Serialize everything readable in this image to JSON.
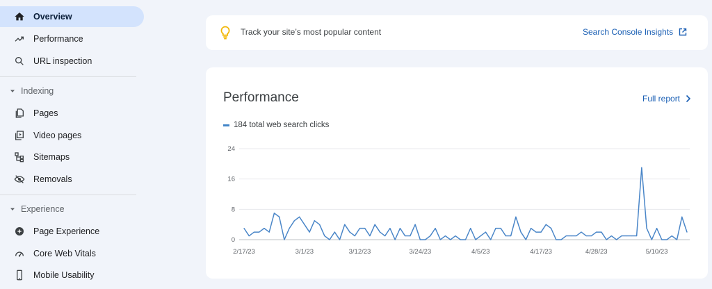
{
  "sidebar": {
    "items": [
      {
        "label": "Overview",
        "icon": "home-icon",
        "active": true
      },
      {
        "label": "Performance",
        "icon": "trending-up-icon"
      },
      {
        "label": "URL inspection",
        "icon": "search-icon"
      }
    ],
    "indexing": {
      "header": "Indexing",
      "items": [
        {
          "label": "Pages",
          "icon": "pages-icon"
        },
        {
          "label": "Video pages",
          "icon": "video-pages-icon"
        },
        {
          "label": "Sitemaps",
          "icon": "sitemap-icon"
        },
        {
          "label": "Removals",
          "icon": "removals-icon"
        }
      ]
    },
    "experience": {
      "header": "Experience",
      "items": [
        {
          "label": "Page Experience",
          "icon": "page-experience-icon"
        },
        {
          "label": "Core Web Vitals",
          "icon": "speedometer-icon"
        },
        {
          "label": "Mobile Usability",
          "icon": "mobile-icon"
        }
      ]
    }
  },
  "insight": {
    "text": "Track your site’s most popular content",
    "link": "Search Console Insights",
    "icon": "lightbulb-icon",
    "link_icon": "open-in-new-icon"
  },
  "performance": {
    "title": "Performance",
    "full_report": "Full report",
    "legend": "184 total web search clicks"
  },
  "colors": {
    "accent": "#1a5fb4",
    "active_bg": "#d3e3fd",
    "line": "#4a86c8",
    "bulb": "#f2b600"
  },
  "chart_data": {
    "type": "line",
    "x_tick_labels": [
      "2/17/23",
      "3/1/23",
      "3/12/23",
      "3/24/23",
      "4/5/23",
      "4/17/23",
      "4/28/23",
      "5/10/23"
    ],
    "x_tick_index": [
      0,
      12,
      23,
      35,
      47,
      59,
      70,
      82
    ],
    "ylim": [
      0,
      24
    ],
    "y_ticks": [
      0,
      8,
      16,
      24
    ],
    "grid": true,
    "series": [
      {
        "values": [
          3,
          1,
          2,
          2,
          3,
          2,
          7,
          6,
          0,
          3,
          5,
          6,
          4,
          2,
          5,
          4,
          1,
          0,
          2,
          0,
          4,
          2,
          1,
          3,
          3,
          1,
          4,
          2,
          1,
          3,
          0,
          3,
          1,
          1,
          4,
          0,
          0,
          1,
          3,
          0,
          1,
          0,
          1,
          0,
          0,
          3,
          0,
          1,
          2,
          0,
          3,
          3,
          1,
          1,
          6,
          2,
          0,
          3,
          2,
          2,
          4,
          3,
          0,
          0,
          1,
          1,
          1,
          2,
          1,
          1,
          2,
          2,
          0,
          1,
          0,
          1,
          1,
          1,
          1,
          19,
          3,
          0,
          3,
          0,
          0,
          1,
          0,
          6,
          2
        ]
      }
    ]
  }
}
